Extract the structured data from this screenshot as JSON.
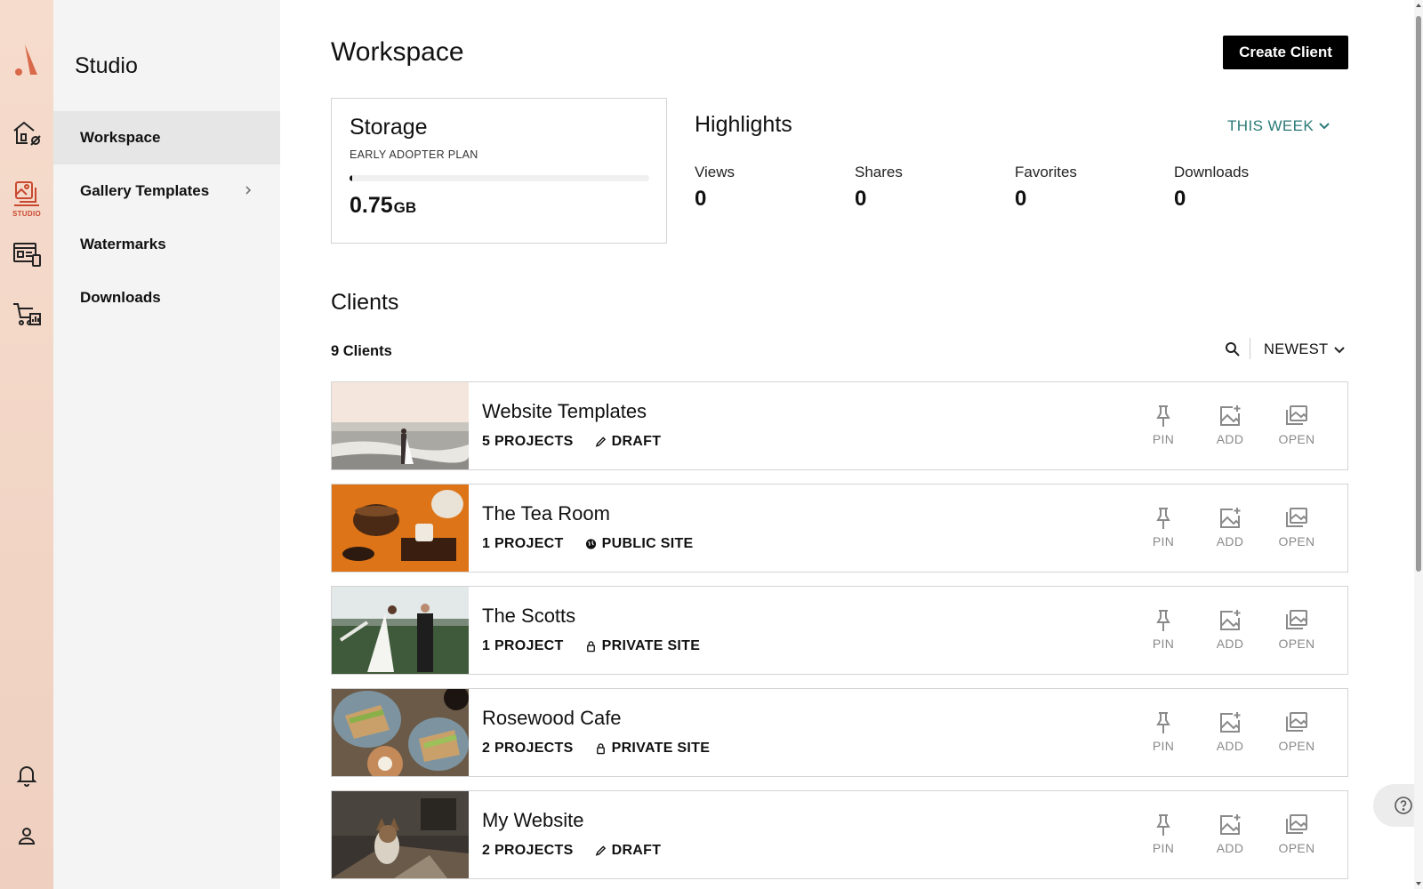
{
  "rail": {
    "studio_label": "STUDIO",
    "accent": "#c9482f"
  },
  "sidebar": {
    "brand": "Studio",
    "items": [
      {
        "label": "Workspace",
        "active": true
      },
      {
        "label": "Gallery Templates",
        "has_submenu": true
      },
      {
        "label": "Watermarks"
      },
      {
        "label": "Downloads"
      }
    ]
  },
  "header": {
    "title": "Workspace",
    "create_label": "Create Client"
  },
  "storage": {
    "title": "Storage",
    "plan": "EARLY ADOPTER PLAN",
    "value": "0.75",
    "unit": "GB",
    "fill_fraction": 0.008
  },
  "highlights": {
    "title": "Highlights",
    "period": "THIS WEEK",
    "stats": [
      {
        "label": "Views",
        "value": "0"
      },
      {
        "label": "Shares",
        "value": "0"
      },
      {
        "label": "Favorites",
        "value": "0"
      },
      {
        "label": "Downloads",
        "value": "0"
      }
    ]
  },
  "clients": {
    "title": "Clients",
    "count": "9 Clients",
    "sort": "NEWEST",
    "actions": {
      "pin": "PIN",
      "add": "ADD",
      "open": "OPEN"
    },
    "rows": [
      {
        "name": "Website Templates",
        "projects": "5 PROJECTS",
        "status": "DRAFT",
        "status_icon": "pencil-icon"
      },
      {
        "name": "The Tea Room",
        "projects": "1 PROJECT",
        "status": "PUBLIC SITE",
        "status_icon": "globe-icon"
      },
      {
        "name": "The Scotts",
        "projects": "1 PROJECT",
        "status": "PRIVATE SITE",
        "status_icon": "lock-icon"
      },
      {
        "name": "Rosewood Cafe",
        "projects": "2 PROJECTS",
        "status": "PRIVATE SITE",
        "status_icon": "lock-icon"
      },
      {
        "name": "My Website",
        "projects": "2 PROJECTS",
        "status": "DRAFT",
        "status_icon": "pencil-icon"
      }
    ]
  },
  "colors": {
    "accent_teal": "#2a7a78",
    "button_black": "#000000",
    "icon_gray": "#8a8a8a"
  }
}
